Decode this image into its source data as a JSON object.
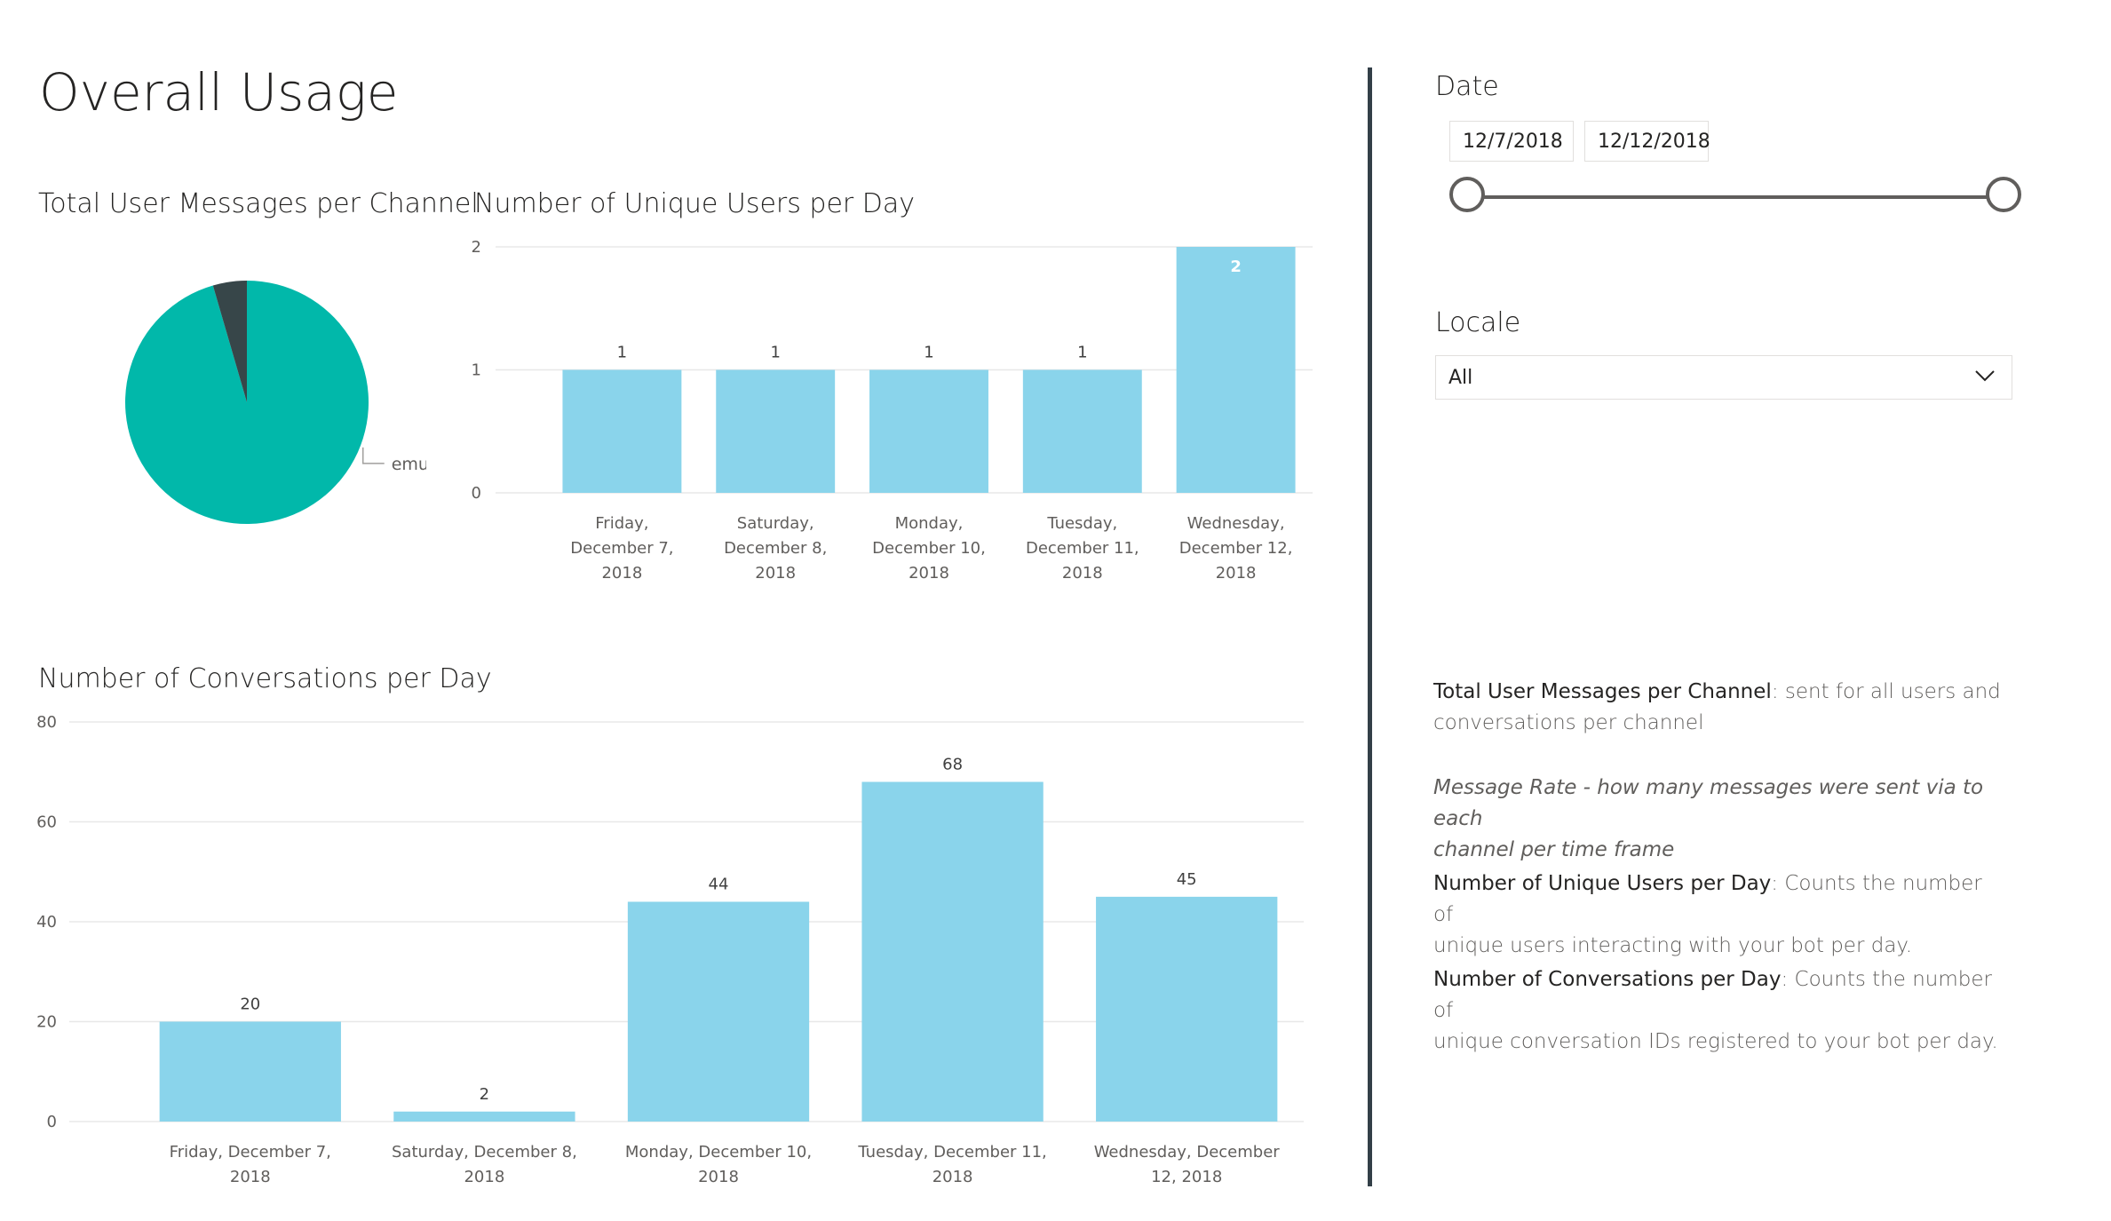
{
  "page": {
    "title": "Overall Usage"
  },
  "charts": {
    "messages_title": "Total User Messages per Channel",
    "users_title": "Number of Unique Users per Day",
    "conversations_title": "Number of Conversations per Day"
  },
  "chart_data": [
    {
      "type": "pie",
      "title": "Total User Messages per Channel",
      "slices": [
        {
          "label": "emulator",
          "value": 95.5,
          "color": "#01b8aa"
        },
        {
          "label": "",
          "value": 4.5,
          "color": "#374649"
        }
      ],
      "visible_labels": [
        "emulator"
      ]
    },
    {
      "type": "bar",
      "title": "Number of Unique Users per Day",
      "categories": [
        [
          "Friday,",
          "December 7,",
          "2018"
        ],
        [
          "Saturday,",
          "December 8,",
          "2018"
        ],
        [
          "Monday,",
          "December 10,",
          "2018"
        ],
        [
          "Tuesday,",
          "December 11,",
          "2018"
        ],
        [
          "Wednesday,",
          "December 12,",
          "2018"
        ]
      ],
      "values": [
        1,
        1,
        1,
        1,
        2
      ],
      "yticks": [
        0,
        1,
        2
      ],
      "ylim": [
        0,
        2
      ],
      "color": "#8ad4eb",
      "grid": true
    },
    {
      "type": "bar",
      "title": "Number of Conversations per Day",
      "categories": [
        [
          "Friday, December 7,",
          "2018"
        ],
        [
          "Saturday, December 8,",
          "2018"
        ],
        [
          "Monday, December 10,",
          "2018"
        ],
        [
          "Tuesday, December 11,",
          "2018"
        ],
        [
          "Wednesday, December",
          "12, 2018"
        ]
      ],
      "values": [
        20,
        2,
        44,
        68,
        45
      ],
      "yticks": [
        0,
        20,
        40,
        60,
        80
      ],
      "ylim": [
        0,
        80
      ],
      "color": "#8ad4eb",
      "grid": true
    }
  ],
  "date_slicer": {
    "title": "Date",
    "start": "12/7/2018",
    "end": "12/12/2018",
    "range_fraction": [
      0,
      1
    ]
  },
  "locale_slicer": {
    "title": "Locale",
    "value": "All"
  },
  "descriptions": {
    "d1_term": "Total User Messages per Channel",
    "d1_line1_rest": ": sent for all users and",
    "d1_line2": "conversations per channel",
    "d2_line1": "Message Rate - how many messages were sent via to each",
    "d2_line2": "channel per time frame",
    "d3_term": "Number of Unique Users per Day",
    "d3_line1_rest": ": Counts the number of",
    "d3_line2": "unique users interacting with your bot per day.",
    "d4_term": "Number of Conversations per Day",
    "d4_line1_rest": ": Counts the number of",
    "d4_line2": "unique conversation IDs registered to your bot per day."
  },
  "colors": {
    "teal": "#01b8aa",
    "dark_slice": "#374649",
    "bar": "#8ad4eb",
    "divider": "#333f48",
    "grid": "#e8e8e8",
    "axis_text": "#605e5c"
  }
}
